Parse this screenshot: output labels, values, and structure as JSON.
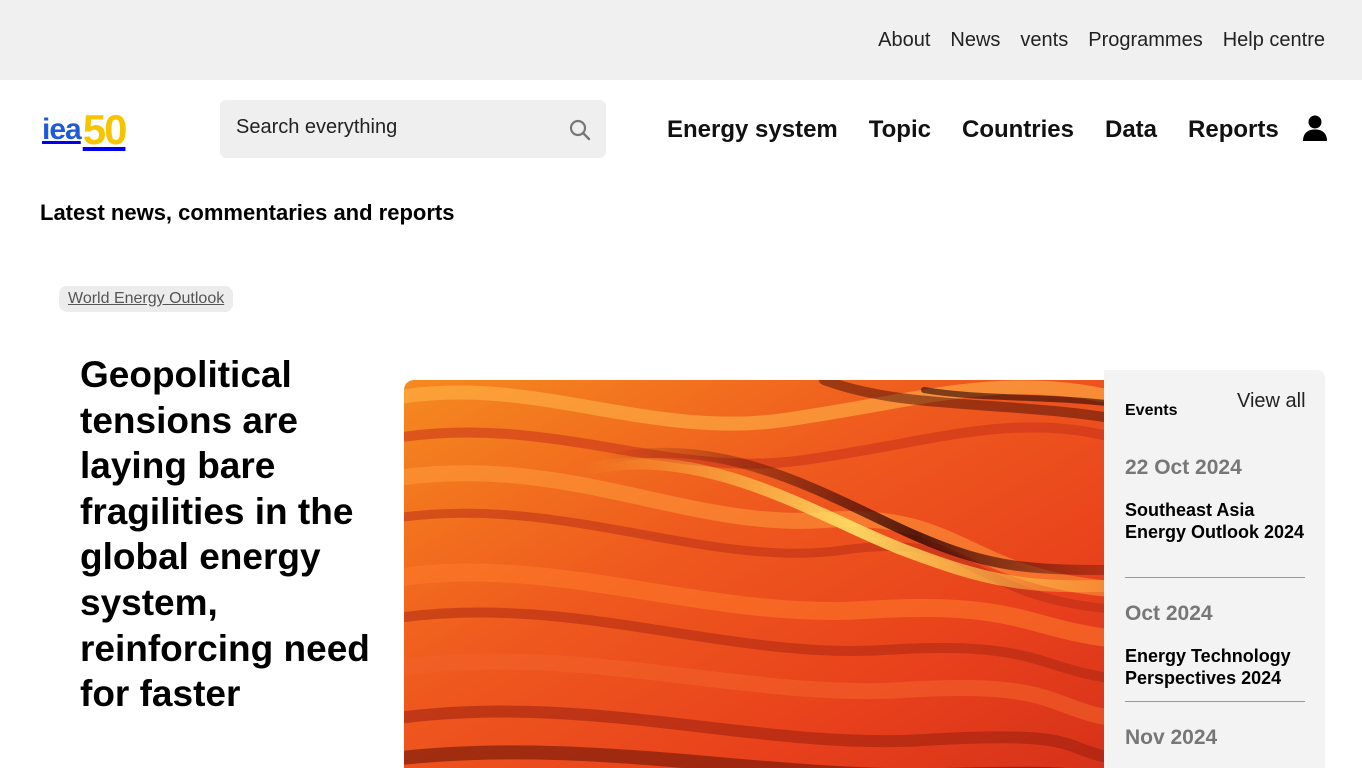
{
  "utility_nav": [
    "About",
    "News",
    "vents",
    "Programmes",
    "Help centre"
  ],
  "logo": {
    "text_iea": "iea",
    "text_50": "50",
    "color_iea": "#1f5bd9",
    "color_50": "#f6c400"
  },
  "search": {
    "placeholder": "Search everything",
    "icon": "search-icon"
  },
  "main_nav": [
    "Energy system",
    "Topic",
    "Countries",
    "Data",
    "Reports"
  ],
  "account_icon": "user-icon",
  "section_title": "Latest news, commentaries and reports",
  "featured": {
    "tag": "World Energy Outlook",
    "headline": "Geopolitical tensions are laying bare fragilities in the global energy system, reinforcing need for faster"
  },
  "events": {
    "title": "Events",
    "view_all": "View all",
    "items": [
      {
        "date": "22 Oct 2024",
        "name": "Southeast Asia Energy Outlook 2024"
      },
      {
        "date": "Oct 2024",
        "name": "Energy Technology Perspectives 2024"
      },
      {
        "date": "Nov 2024",
        "name": ""
      }
    ]
  },
  "colors": {
    "utility_bg": "#f0f0f0",
    "search_bg": "#efefef",
    "events_bg": "#f3f3f3",
    "date_gray": "#777777"
  }
}
